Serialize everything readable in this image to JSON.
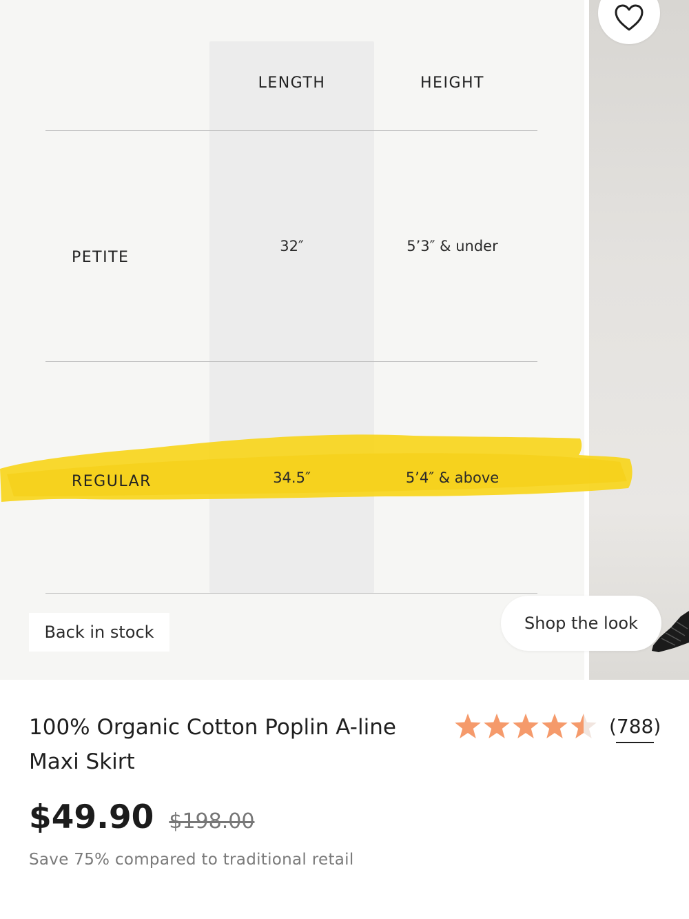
{
  "size_chart": {
    "headers": [
      "LENGTH",
      "HEIGHT"
    ],
    "rows": [
      {
        "label": "PETITE",
        "length": "32″",
        "height": "5’3″ & under"
      },
      {
        "label": "REGULAR",
        "length": "34.5″",
        "height": "5’4″ & above"
      }
    ],
    "highlighted_row": "REGULAR",
    "highlight_color": "#f8d51e"
  },
  "badges": {
    "back_in_stock": "Back in stock",
    "shop_the_look": "Shop the look"
  },
  "icons": {
    "favorite": "heart-outline-icon"
  },
  "product": {
    "title": "100% Organic Cotton Poplin A-line Maxi Skirt",
    "rating": 4.5,
    "rating_max": 5,
    "star_color": "#f59a6b",
    "review_count": "(788)",
    "price": "$49.90",
    "compare_price": "$198.00",
    "savings_text": "Save 75% compared to traditional retail"
  }
}
